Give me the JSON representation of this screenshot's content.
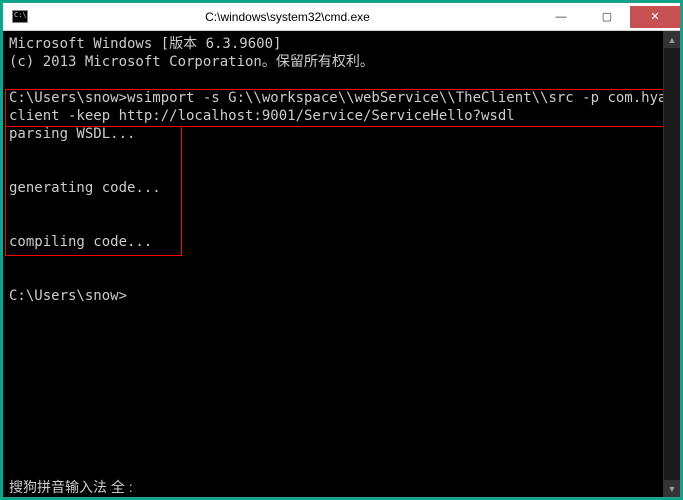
{
  "title": "C:\\windows\\system32\\cmd.exe",
  "icon": "cmd-icon",
  "controls": {
    "min": "—",
    "max": "▢",
    "close": "✕"
  },
  "lines": [
    "Microsoft Windows [版本 6.3.9600]",
    "(c) 2013 Microsoft Corporation。保留所有权利。",
    "",
    "C:\\Users\\snow>wsimport -s G:\\\\workspace\\\\webService\\\\TheClient\\\\src -p com.hyan.",
    "client -keep http://localhost:9001/Service/ServiceHello?wsdl",
    "parsing WSDL...",
    "",
    "",
    "generating code...",
    "",
    "",
    "compiling code...",
    "",
    "",
    "C:\\Users\\snow>"
  ],
  "status": "搜狗拼音输入法 全 :",
  "scrollbar": {
    "up": "▲",
    "down": "▼"
  }
}
